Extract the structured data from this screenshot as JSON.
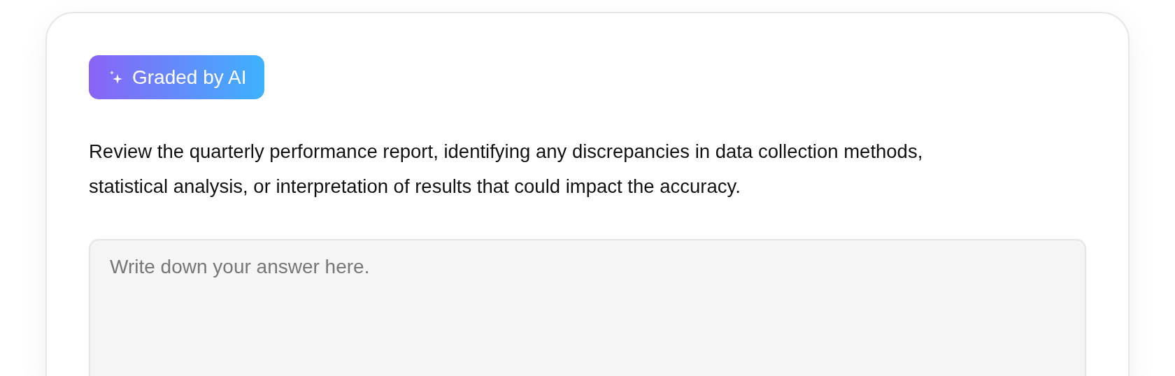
{
  "badge": {
    "label": "Graded by AI"
  },
  "question": {
    "text": "Review the quarterly performance report, identifying any discrepancies in data collection methods, statistical analysis, or interpretation of results that could impact the accuracy."
  },
  "answer": {
    "placeholder": "Write down your answer here."
  }
}
